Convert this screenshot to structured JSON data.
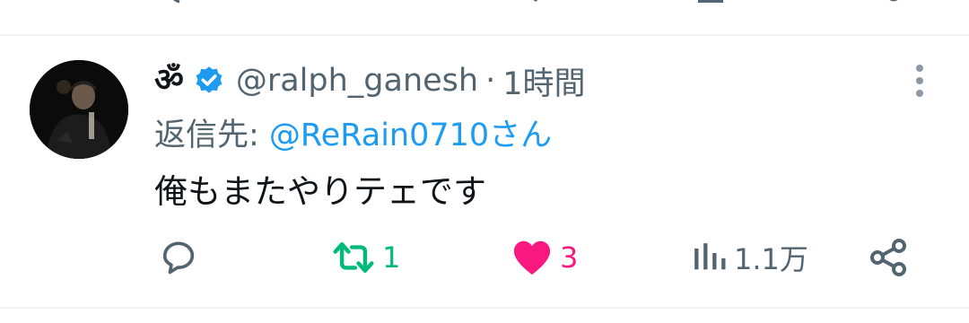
{
  "tweet": {
    "display_name": "ॐ",
    "handle": "@ralph_ganesh",
    "separator": "·",
    "time": "1時間",
    "reply_label": "返信先: ",
    "reply_mention": "@ReRain0710さん",
    "text": "俺もまたやりテェです",
    "verified": true
  },
  "actions": {
    "reply_icon": "reply-bubble-icon",
    "retweet_icon": "retweet-icon",
    "retweet_count": "1",
    "like_icon": "heart-filled-icon",
    "like_count": "3",
    "views_icon": "views-bar-chart-icon",
    "views_count": "1.1万",
    "share_icon": "share-icon"
  },
  "colors": {
    "text": "#0f1419",
    "secondary": "#536471",
    "link": "#1d9bf0",
    "retweet": "#00ba7c",
    "like": "#f91880",
    "divider": "#eff3f4"
  }
}
